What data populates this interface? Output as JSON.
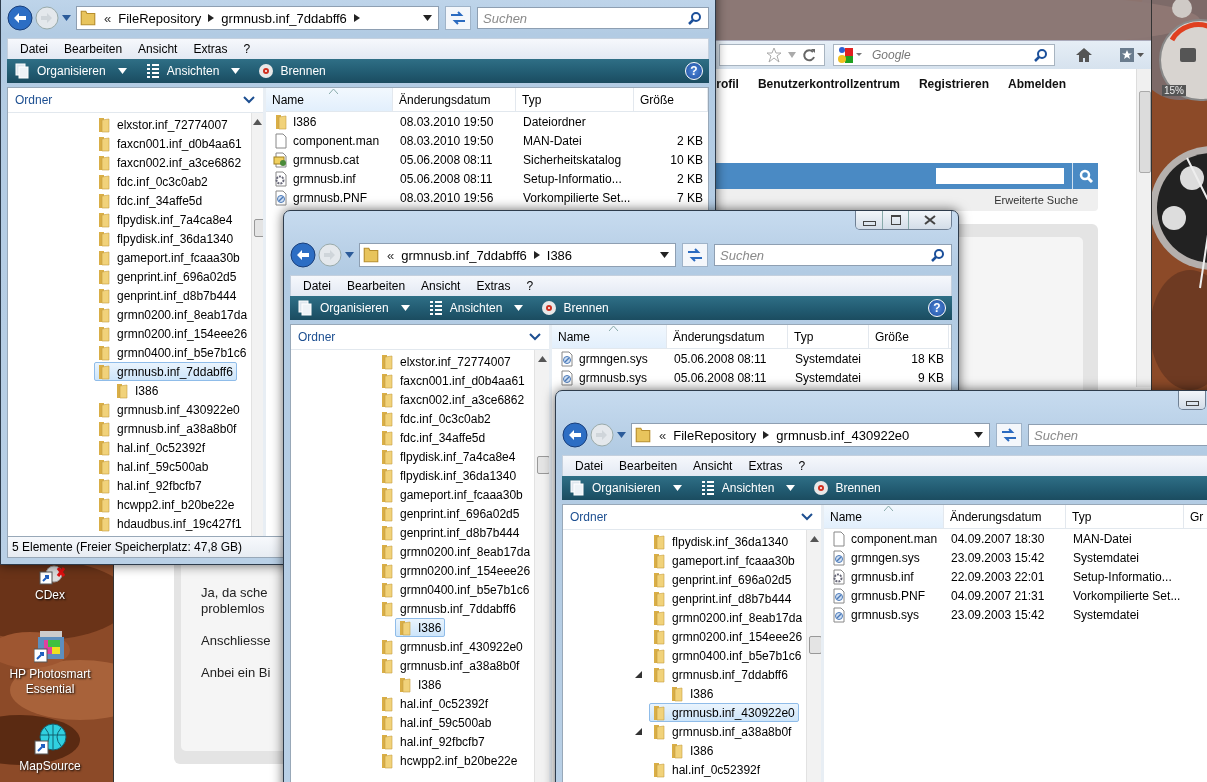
{
  "desktop": {
    "icons": [
      {
        "label": "CDex"
      },
      {
        "label": "HP Photosmart Essential"
      },
      {
        "label": "MapSource"
      }
    ],
    "cpu_reading": "15%"
  },
  "browser": {
    "search_placeholder": "Google",
    "nav_links": [
      "rofil",
      "Benutzerkontrollzentrum",
      "Registrieren",
      "Abmelden"
    ],
    "advanced_search": "Erweiterte Suche",
    "post_lines": [
      "Ja, da sche",
      "problemlos",
      "Anschliesse",
      "Anbei ein Bi"
    ]
  },
  "windows": [
    {
      "title_bar": false,
      "cut_at_right": false,
      "breadcrumb": [
        "FileRepository",
        "grmnusb.inf_7ddabff6"
      ],
      "trailing_separator": true,
      "overflow_mark": "«",
      "search_placeholder": "Suchen",
      "menu": [
        "Datei",
        "Bearbeiten",
        "Ansicht",
        "Extras",
        "?"
      ],
      "toolbar": [
        "Organisieren",
        "Ansichten",
        "Brennen"
      ],
      "help": "?",
      "tree_header": "Ordner",
      "tree": [
        {
          "label": "elxstor.inf_72774007",
          "selected": false
        },
        {
          "label": "faxcn001.inf_d0b4aa61",
          "selected": false
        },
        {
          "label": "faxcn002.inf_a3ce6862",
          "selected": false
        },
        {
          "label": "fdc.inf_0c3c0ab2",
          "selected": false
        },
        {
          "label": "fdc.inf_34affe5d",
          "selected": false
        },
        {
          "label": "flpydisk.inf_7a4ca8e4",
          "selected": false
        },
        {
          "label": "flpydisk.inf_36da1340",
          "selected": false
        },
        {
          "label": "gameport.inf_fcaaa30b",
          "selected": false
        },
        {
          "label": "genprint.inf_696a02d5",
          "selected": false
        },
        {
          "label": "genprint.inf_d8b7b444",
          "selected": false
        },
        {
          "label": "grmn0200.inf_8eab17da",
          "selected": false
        },
        {
          "label": "grmn0200.inf_154eee26",
          "selected": false
        },
        {
          "label": "grmn0400.inf_b5e7b1c6",
          "selected": false
        },
        {
          "label": "grmnusb.inf_7ddabff6",
          "selected": true,
          "children": [
            {
              "label": "I386",
              "selected": false
            }
          ]
        },
        {
          "label": "grmnusb.inf_430922e0",
          "selected": false
        },
        {
          "label": "grmnusb.inf_a38a8b0f",
          "selected": false
        },
        {
          "label": "hal.inf_0c52392f",
          "selected": false
        },
        {
          "label": "hal.inf_59c500ab",
          "selected": false
        },
        {
          "label": "hal.inf_92fbcfb7",
          "selected": false
        },
        {
          "label": "hcwpp2.inf_b20be22e",
          "selected": false
        },
        {
          "label": "hdaudbus.inf_19c427f1",
          "selected": false
        }
      ],
      "columns": [
        "Name",
        "Änderungsdatum",
        "Typ",
        "Größe"
      ],
      "files": [
        {
          "name": "I386",
          "kind": "folder",
          "date": "08.03.2010 19:50",
          "type": "Dateiordner",
          "selected": false
        },
        {
          "name": "component.man",
          "kind": "man",
          "date": "08.03.2010 19:50",
          "type": "MAN-Datei",
          "size": "2 KB",
          "selected": false
        },
        {
          "name": "grmnusb.cat",
          "kind": "cat",
          "date": "05.06.2008 08:11",
          "type": "Sicherheitskatalog",
          "size": "10 KB",
          "selected": false
        },
        {
          "name": "grmnusb.inf",
          "kind": "inf",
          "date": "05.06.2008 08:11",
          "type": "Setup-Informatio...",
          "size": "2 KB",
          "selected": false
        },
        {
          "name": "grmnusb.PNF",
          "kind": "pnf",
          "date": "08.03.2010 19:56",
          "type": "Vorkompilierte Set...",
          "size": "7 KB",
          "selected": false
        }
      ],
      "status": "5 Elemente (Freier Speicherplatz: 47,8 GB)"
    },
    {
      "title_bar": true,
      "cut_at_right": false,
      "breadcrumb": [
        "grmnusb.inf_7ddabff6",
        "I386"
      ],
      "trailing_separator": false,
      "overflow_mark": "«",
      "search_placeholder": "Suchen",
      "menu": [
        "Datei",
        "Bearbeiten",
        "Ansicht",
        "Extras",
        "?"
      ],
      "toolbar": [
        "Organisieren",
        "Ansichten",
        "Brennen"
      ],
      "help": "?",
      "tree_header": "Ordner",
      "tree": [
        {
          "label": "elxstor.inf_72774007",
          "selected": false
        },
        {
          "label": "faxcn001.inf_d0b4aa61",
          "selected": false
        },
        {
          "label": "faxcn002.inf_a3ce6862",
          "selected": false
        },
        {
          "label": "fdc.inf_0c3c0ab2",
          "selected": false
        },
        {
          "label": "fdc.inf_34affe5d",
          "selected": false
        },
        {
          "label": "flpydisk.inf_7a4ca8e4",
          "selected": false
        },
        {
          "label": "flpydisk.inf_36da1340",
          "selected": false
        },
        {
          "label": "gameport.inf_fcaaa30b",
          "selected": false
        },
        {
          "label": "genprint.inf_696a02d5",
          "selected": false
        },
        {
          "label": "genprint.inf_d8b7b444",
          "selected": false
        },
        {
          "label": "grmn0200.inf_8eab17da",
          "selected": false
        },
        {
          "label": "grmn0200.inf_154eee26",
          "selected": false
        },
        {
          "label": "grmn0400.inf_b5e7b1c6",
          "selected": false
        },
        {
          "label": "grmnusb.inf_7ddabff6",
          "selected": false,
          "children": [
            {
              "label": "I386",
              "selected": true
            }
          ]
        },
        {
          "label": "grmnusb.inf_430922e0",
          "selected": false
        },
        {
          "label": "grmnusb.inf_a38a8b0f",
          "selected": false,
          "children": [
            {
              "label": "I386",
              "selected": false
            }
          ]
        },
        {
          "label": "hal.inf_0c52392f",
          "selected": false
        },
        {
          "label": "hal.inf_59c500ab",
          "selected": false
        },
        {
          "label": "hal.inf_92fbcfb7",
          "selected": false
        },
        {
          "label": "hcwpp2.inf_b20be22e",
          "selected": false
        }
      ],
      "columns": [
        "Name",
        "Änderungsdatum",
        "Typ",
        "Größe"
      ],
      "files": [
        {
          "name": "grmngen.sys",
          "kind": "sys",
          "date": "05.06.2008 08:11",
          "type": "Systemdatei",
          "size": "18 KB",
          "selected": false
        },
        {
          "name": "grmnusb.sys",
          "kind": "sys",
          "date": "05.06.2008 08:11",
          "type": "Systemdatei",
          "size": "9 KB",
          "selected": false
        }
      ]
    },
    {
      "title_bar": true,
      "cut_at_right": true,
      "breadcrumb": [
        "FileRepository",
        "grmnusb.inf_430922e0"
      ],
      "trailing_separator": false,
      "overflow_mark": "«",
      "search_placeholder": "Suchen",
      "menu": [
        "Datei",
        "Bearbeiten",
        "Ansicht",
        "Extras",
        "?"
      ],
      "toolbar": [
        "Organisieren",
        "Ansichten",
        "Brennen"
      ],
      "tree_header": "Ordner",
      "tree": [
        {
          "label": "flpydisk.inf_36da1340",
          "selected": false
        },
        {
          "label": "gameport.inf_fcaaa30b",
          "selected": false
        },
        {
          "label": "genprint.inf_696a02d5",
          "selected": false
        },
        {
          "label": "genprint.inf_d8b7b444",
          "selected": false
        },
        {
          "label": "grmn0200.inf_8eab17da",
          "selected": false
        },
        {
          "label": "grmn0200.inf_154eee26",
          "selected": false
        },
        {
          "label": "grmn0400.inf_b5e7b1c6",
          "selected": false
        },
        {
          "label": "grmnusb.inf_7ddabff6",
          "selected": false,
          "expanded": true,
          "children": [
            {
              "label": "I386",
              "selected": false
            }
          ]
        },
        {
          "label": "grmnusb.inf_430922e0",
          "selected": true
        },
        {
          "label": "grmnusb.inf_a38a8b0f",
          "selected": false,
          "expanded": true,
          "children": [
            {
              "label": "I386",
              "selected": false
            }
          ]
        },
        {
          "label": "hal.inf_0c52392f",
          "selected": false
        }
      ],
      "columns": [
        "Name",
        "Änderungsdatum",
        "Typ",
        "Gr"
      ],
      "files": [
        {
          "name": "component.man",
          "kind": "man",
          "date": "04.09.2007 18:30",
          "type": "MAN-Datei",
          "selected": false
        },
        {
          "name": "grmngen.sys",
          "kind": "sys",
          "date": "23.09.2003 15:42",
          "type": "Systemdatei",
          "selected": false
        },
        {
          "name": "grmnusb.inf",
          "kind": "inf",
          "date": "22.09.2003 22:01",
          "type": "Setup-Informatio...",
          "selected": false
        },
        {
          "name": "grmnusb.PNF",
          "kind": "pnf",
          "date": "04.09.2007 21:31",
          "type": "Vorkompilierte Set...",
          "selected": false
        },
        {
          "name": "grmnusb.sys",
          "kind": "sys",
          "date": "23.09.2003 15:42",
          "type": "Systemdatei",
          "selected": false
        }
      ]
    }
  ]
}
